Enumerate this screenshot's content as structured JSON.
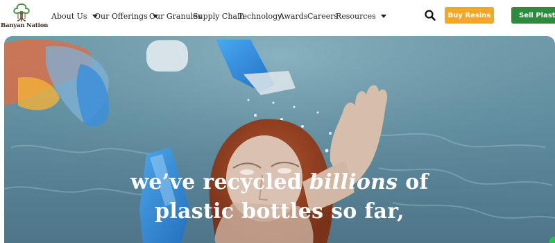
{
  "brand": {
    "name": "Banyan Nation",
    "logo_icon": "banyan-tree-icon",
    "colors": {
      "tree": "#3e8e3a",
      "trunk": "#6b4a2a"
    }
  },
  "nav": {
    "items": [
      {
        "label": "About Us",
        "has_dropdown": true
      },
      {
        "label": "Our Offerings",
        "has_dropdown": true
      },
      {
        "label": "Our Granules",
        "has_dropdown": false
      },
      {
        "label": "Supply Chain",
        "has_dropdown": false
      },
      {
        "label": "Technology",
        "has_dropdown": false
      },
      {
        "label": "Awards",
        "has_dropdown": false
      },
      {
        "label": "Careers",
        "has_dropdown": false
      },
      {
        "label": "Resources",
        "has_dropdown": true
      }
    ],
    "search_icon": "search-icon"
  },
  "actions": {
    "buy_label": "Buy Resins",
    "sell_label": "Sell Plastic",
    "buy_color": "#f5a623",
    "sell_color": "#2e8b3e"
  },
  "hero": {
    "headline_line1_pre": "we’ve recycled ",
    "headline_line1_em": "billions",
    "headline_line1_post": " of",
    "headline_line2": "plastic bottles so far,"
  },
  "chat": {
    "icon": "chat-icon",
    "color": "#27c24c"
  }
}
